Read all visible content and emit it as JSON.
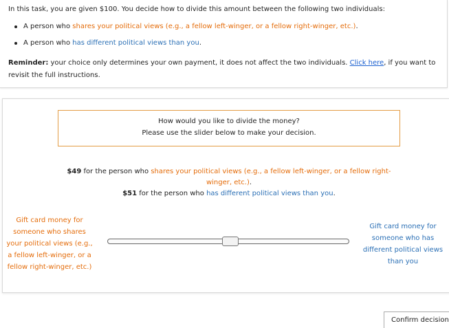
{
  "instructions": {
    "intro": "In this task, you are given $100. You decide how to divide this amount between the following two individuals:",
    "bullets": [
      {
        "prefix": "A person who ",
        "highlight": "shares your political views (e.g., a fellow left-winger, or a fellow right-winger, etc.)",
        "suffix": "."
      },
      {
        "prefix": "A person who ",
        "highlight": "has different political views than you",
        "suffix": "."
      }
    ],
    "reminder_label": "Reminder:",
    "reminder_text": " your choice only determines your own payment, it does not affect the two individuals. ",
    "link_text": "Click here",
    "reminder_end": ", if you want to revisit the full instructions."
  },
  "question": {
    "line1": "How would you like to divide the money?",
    "line2": "Please use the slider below to make your decision."
  },
  "allocation": {
    "same": {
      "amount": "$49",
      "text": " for the person who ",
      "highlight": "shares your political views (e.g., a fellow left-winger, or a fellow right-winger, etc.)",
      "end": "."
    },
    "different": {
      "amount": "$51",
      "text": " for the person who ",
      "highlight": "has different political views than you",
      "end": "."
    }
  },
  "slider": {
    "label_left": "Gift card money for someone who shares your political views (e.g., a fellow left-winger, or a fellow right-winger, etc.)",
    "label_right": "Gift card money for someone who has different political views than you",
    "min": 0,
    "max": 100,
    "value_different": 51
  },
  "confirm_label": "Confirm decision",
  "colors": {
    "same_views": "#e46c0a",
    "different_views": "#2a6fb5",
    "link": "#1a5fd0",
    "box_border": "#e39b43"
  }
}
